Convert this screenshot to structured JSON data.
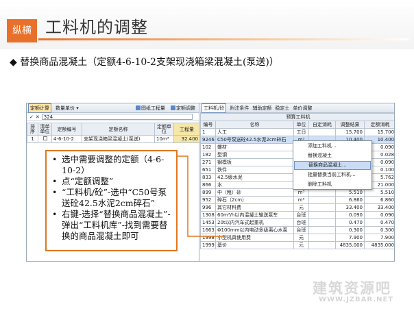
{
  "slide": {
    "logo": "纵横",
    "title": "工料机的调整",
    "subtitle_bullet": "◆",
    "subtitle": "替换商品混凝土（定额4-6-10-2支架现浇箱梁混凝土(泵送)）"
  },
  "left_panel": {
    "toolbar": {
      "tab_active": "定额计算",
      "quantity": "数量单价 ▾",
      "drawing_qty": "图纸工程量",
      "quota_adjust": "定额调整"
    },
    "input": {
      "check": "✓",
      "cross": "✕",
      "value": "324"
    },
    "columns": [
      "排序",
      "清单单位",
      "定额编号",
      "定额名称",
      "定额单位",
      "工程量"
    ],
    "rows": [
      {
        "index": "1",
        "code": "4-6-10-2",
        "name": "支架现浇箱梁混凝土(泵送)",
        "unit": "10m³",
        "qty": "32.400"
      }
    ]
  },
  "right_panel": {
    "tabs": [
      "工料机/砼",
      "附注条件",
      "辅助定额",
      "稳定土",
      "单价调整"
    ],
    "table_caption": "预算工料机",
    "columns": [
      "编号",
      "名称",
      "单位",
      "自定消耗",
      "调整结果",
      "定额消耗"
    ],
    "rows": [
      {
        "code": "1",
        "name": "人工",
        "unit": "工日",
        "custom": "",
        "result": "15.700",
        "quota": "15.700"
      },
      {
        "code": "9246",
        "name": "C50号泵送砼42.5水泥2cm碎石",
        "unit": "m³",
        "custom": "",
        "result": "10.400",
        "quota": "10.400"
      },
      {
        "code": "102",
        "name": "螺材",
        "unit": "",
        "custom": "",
        "result": "",
        "quota": "0.090"
      },
      {
        "code": "182",
        "name": "型钢",
        "unit": "",
        "custom": "",
        "result": "",
        "quota": "0.028"
      },
      {
        "code": "271",
        "name": "钢模板",
        "unit": "",
        "custom": "",
        "result": "",
        "quota": "0.090"
      },
      {
        "code": "651",
        "name": "铁件",
        "unit": "",
        "custom": "",
        "result": "",
        "quota": "0.100"
      },
      {
        "code": "833",
        "name": "42.5级水泥",
        "unit": "",
        "custom": "",
        "result": "",
        "quota": "5.762"
      },
      {
        "code": "866",
        "name": "水",
        "unit": "",
        "custom": "",
        "result": "21.000",
        "quota": "21.000"
      },
      {
        "code": "899",
        "name": "中（粗）砂",
        "unit": "m³",
        "custom": "",
        "result": "5.510",
        "quota": "5.510"
      },
      {
        "code": "952",
        "name": "碎石（2cm）",
        "unit": "m³",
        "custom": "",
        "result": "6.860",
        "quota": "6.860"
      },
      {
        "code": "996",
        "name": "其它材料费",
        "unit": "元",
        "custom": "",
        "result": "33.400",
        "quota": "33.400"
      },
      {
        "code": "1308",
        "name": "60m³/h以内混凝土输送泵车",
        "unit": "台班",
        "custom": "",
        "result": "0.090",
        "quota": "0.090"
      },
      {
        "code": "1453",
        "name": "20t以内汽车式起重机",
        "unit": "台班",
        "custom": "",
        "result": "0.470",
        "quota": "0.470"
      },
      {
        "code": "1663",
        "name": "Φ100mm以内电动多级离心水泵",
        "unit": "台班",
        "custom": "",
        "result": "0.300",
        "quota": "0.300"
      },
      {
        "code": "1998",
        "name": "小型机具使用费",
        "unit": "元",
        "custom": "",
        "result": "7.900",
        "quota": "7.900"
      },
      {
        "code": "1999",
        "name": "基价",
        "unit": "元",
        "custom": "",
        "result": "4835.000",
        "quota": "4835.000"
      }
    ]
  },
  "context_menu": {
    "items": [
      "添加工料机...",
      "替换混凝土",
      "替换商品混凝土...",
      "批量替换当前工料机...",
      "删除工料机"
    ],
    "highlighted_index": 2
  },
  "callout": {
    "items": [
      "选中需要调整的定额（4-6-10-2）",
      "点“定额调整”",
      "“工料机/砼”-选中“C50号泵送砼42.5水泥2cm碎石”",
      "右键-选择“替换商品混凝土”-弹出“工料机库”-找到需要替换的商品混凝土即可"
    ]
  },
  "watermark": {
    "text": "建筑资源吧",
    "url": "WWW.JZBAR.NET"
  },
  "colors": {
    "accent": "#e2761f",
    "menu_highlight": "#c9dcf5",
    "selected_row": "#cfe0f7"
  }
}
